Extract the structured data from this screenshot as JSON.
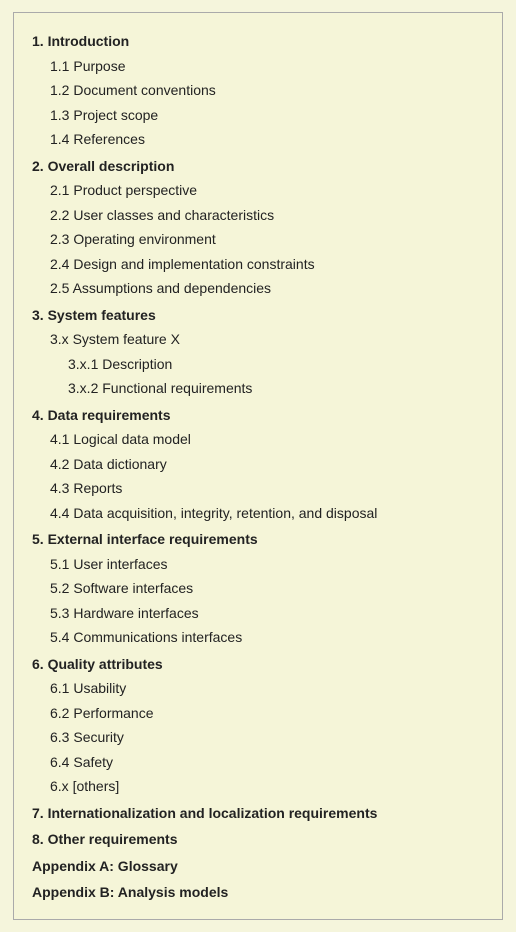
{
  "toc": {
    "items": [
      {
        "level": 1,
        "bold": true,
        "text": "1. Introduction"
      },
      {
        "level": 2,
        "bold": false,
        "text": "1.1 Purpose"
      },
      {
        "level": 2,
        "bold": false,
        "text": "1.2 Document conventions"
      },
      {
        "level": 2,
        "bold": false,
        "text": "1.3 Project scope"
      },
      {
        "level": 2,
        "bold": false,
        "text": "1.4 References"
      },
      {
        "level": 1,
        "bold": true,
        "text": "2. Overall description"
      },
      {
        "level": 2,
        "bold": false,
        "text": "2.1 Product perspective"
      },
      {
        "level": 2,
        "bold": false,
        "text": "2.2 User classes and characteristics"
      },
      {
        "level": 2,
        "bold": false,
        "text": "2.3 Operating environment"
      },
      {
        "level": 2,
        "bold": false,
        "text": "2.4 Design and implementation constraints"
      },
      {
        "level": 2,
        "bold": false,
        "text": "2.5 Assumptions and dependencies"
      },
      {
        "level": 1,
        "bold": true,
        "text": "3. System features"
      },
      {
        "level": 2,
        "bold": false,
        "text": "3.x System feature X"
      },
      {
        "level": 3,
        "bold": false,
        "text": "3.x.1 Description"
      },
      {
        "level": 3,
        "bold": false,
        "text": "3.x.2 Functional requirements"
      },
      {
        "level": 1,
        "bold": true,
        "text": "4. Data requirements"
      },
      {
        "level": 2,
        "bold": false,
        "text": "4.1 Logical data model"
      },
      {
        "level": 2,
        "bold": false,
        "text": "4.2 Data dictionary"
      },
      {
        "level": 2,
        "bold": false,
        "text": "4.3 Reports"
      },
      {
        "level": 2,
        "bold": false,
        "text": "4.4 Data acquisition, integrity, retention, and disposal"
      },
      {
        "level": 1,
        "bold": true,
        "text": "5. External interface requirements"
      },
      {
        "level": 2,
        "bold": false,
        "text": "5.1 User interfaces"
      },
      {
        "level": 2,
        "bold": false,
        "text": "5.2 Software interfaces"
      },
      {
        "level": 2,
        "bold": false,
        "text": "5.3 Hardware interfaces"
      },
      {
        "level": 2,
        "bold": false,
        "text": "5.4 Communications interfaces"
      },
      {
        "level": 1,
        "bold": true,
        "text": "6. Quality attributes"
      },
      {
        "level": 2,
        "bold": false,
        "text": "6.1 Usability"
      },
      {
        "level": 2,
        "bold": false,
        "text": "6.2 Performance"
      },
      {
        "level": 2,
        "bold": false,
        "text": "6.3 Security"
      },
      {
        "level": 2,
        "bold": false,
        "text": "6.4 Safety"
      },
      {
        "level": 2,
        "bold": false,
        "text": "6.x [others]"
      },
      {
        "level": 1,
        "bold": true,
        "text": "7. Internationalization and localization requirements"
      },
      {
        "level": 1,
        "bold": true,
        "text": "8. Other requirements"
      },
      {
        "level": 0,
        "bold": true,
        "text": "Appendix A: Glossary"
      },
      {
        "level": 0,
        "bold": true,
        "text": "Appendix B: Analysis models"
      }
    ]
  }
}
